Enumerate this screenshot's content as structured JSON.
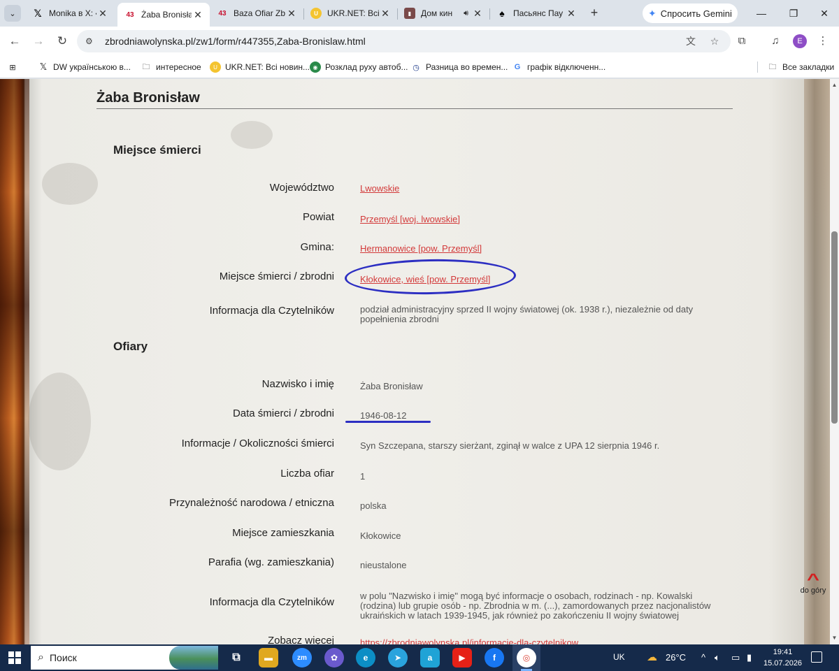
{
  "browser": {
    "tabs": [
      {
        "title": "Monika в X: «",
        "favicon": "x-icon"
      },
      {
        "title": "Żaba Bronisła",
        "favicon": "site-logo-icon"
      },
      {
        "title": "Baza Ofiar Zb",
        "favicon": "site-logo-icon"
      },
      {
        "title": "UKR.NET: Всі",
        "favicon": "ukrnet-icon"
      },
      {
        "title": "Дом кин",
        "favicon": "film-icon"
      },
      {
        "title": "Пасьянс Пау",
        "favicon": "spade-icon"
      }
    ],
    "gemini_label": "Спросить Gemini",
    "url": "zbrodniawolynska.pl/zw1/form/r447355,Zaba-Bronislaw.html",
    "avatar_letter": "E",
    "bookmarks": [
      {
        "label": "DW українською в..."
      },
      {
        "label": "интересное"
      },
      {
        "label": "UKR.NET: Всі новин..."
      },
      {
        "label": "Розклад руху автоб..."
      },
      {
        "label": "Разница во времен..."
      },
      {
        "label": "графік відключенн..."
      }
    ],
    "all_bookmarks": "Все закладки"
  },
  "page": {
    "title": "Żaba Bronisław",
    "death_place_heading": "Miejsce śmierci",
    "death_place": [
      {
        "label": "Województwo",
        "value": "Lwowskie"
      },
      {
        "label": "Powiat",
        "value": "Przemyśl [woj. lwowskie]"
      },
      {
        "label": "Gmina:",
        "value": "Hermanowice [pow. Przemyśl]"
      },
      {
        "label": "Miejsce śmierci / zbrodni",
        "value": "Kłokowice, wieś [pow. Przemyśl]"
      },
      {
        "label": "Informacja dla Czytelników",
        "value": "podział administracyjny sprzed II wojny światowej (ok. 1938 r.), niezależnie od daty popełnienia zbrodni"
      }
    ],
    "victims_heading": "Ofiary",
    "victims": [
      {
        "label": "Nazwisko i imię",
        "value": "Żaba Bronisław"
      },
      {
        "label": "Data śmierci / zbrodni",
        "value": "1946-08-12"
      },
      {
        "label": "Informacje / Okoliczności śmierci",
        "value": "Syn Szczepana, starszy sierżant, zginął w walce z UPA 12 sierpnia 1946 r."
      },
      {
        "label": "Liczba ofiar",
        "value": "1"
      },
      {
        "label": "Przynależność narodowa / etniczna",
        "value": "polska"
      },
      {
        "label": "Miejsce zamieszkania",
        "value": "Kłokowice"
      },
      {
        "label": "Parafia (wg. zamieszkania)",
        "value": "nieustalone"
      },
      {
        "label": "Informacja dla Czytelników",
        "value": "w polu \"Nazwisko i imię\" mogą być informacje o osobach, rodzinach - np. Kowalski (rodzina) lub grupie osób - np. Zbrodnia w m. (...), zamordowanych przez nacjonalistów ukraińskich w latach 1939-1945, jak również po zakończeniu II wojny światowej"
      },
      {
        "label": "Zobacz więcej",
        "value": "https://zbrodniawolynska.pl/informacje-dla-czytelnikow"
      }
    ],
    "back_to_top": "do góry"
  },
  "taskbar": {
    "search_placeholder": "Поиск",
    "language": "UK",
    "temperature": "26°C",
    "time": "19:41",
    "date": "15.07.2026"
  }
}
